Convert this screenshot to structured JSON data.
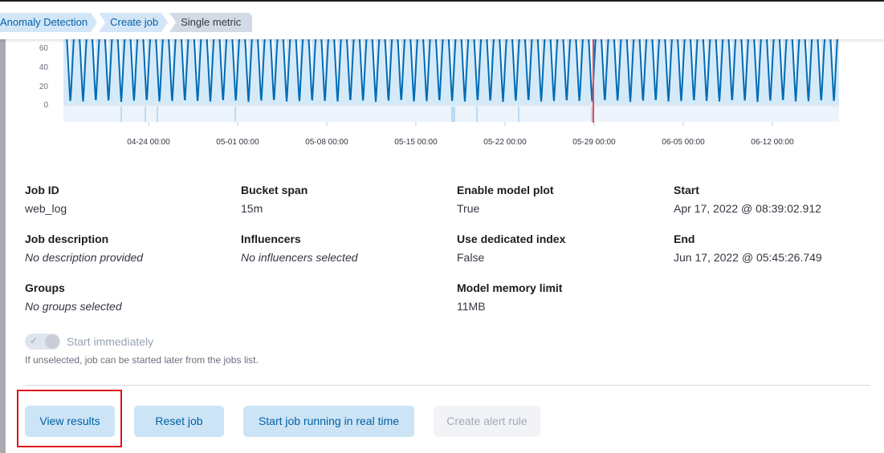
{
  "breadcrumbs": [
    "Anomaly Detection",
    "Create job",
    "Single metric"
  ],
  "chart_data": {
    "type": "line",
    "y_ticks": [
      "0",
      "20",
      "40",
      "60"
    ],
    "x_ticks": [
      "04-24 00:00",
      "05-01 00:00",
      "05-08 00:00",
      "05-15 00:00",
      "05-22 00:00",
      "05-29 00:00",
      "06-05 00:00",
      "06-12 00:00"
    ],
    "line_color": "#006bb4",
    "band_color": "#b9dcf5",
    "marker_color": "#f0454f"
  },
  "details": {
    "job_id": {
      "label": "Job ID",
      "value": "web_log"
    },
    "job_description": {
      "label": "Job description",
      "value": "No description provided"
    },
    "groups": {
      "label": "Groups",
      "value": "No groups selected"
    },
    "bucket_span": {
      "label": "Bucket span",
      "value": "15m"
    },
    "influencers": {
      "label": "Influencers",
      "value": "No influencers selected"
    },
    "enable_model_plot": {
      "label": "Enable model plot",
      "value": "True"
    },
    "use_dedicated_index": {
      "label": "Use dedicated index",
      "value": "False"
    },
    "model_memory_limit": {
      "label": "Model memory limit",
      "value": "11MB"
    },
    "start": {
      "label": "Start",
      "value": "Apr 17, 2022 @ 08:39:02.912"
    },
    "end": {
      "label": "End",
      "value": "Jun 17, 2022 @ 05:45:26.749"
    }
  },
  "start_toggle": {
    "label": "Start immediately",
    "checked": true,
    "disabled": true
  },
  "help_text": "If unselected, job can be started later from the jobs list.",
  "buttons": {
    "view_results": "View results",
    "reset_job": "Reset job",
    "start_realtime": "Start job running in real time",
    "create_alert_rule": "Create alert rule"
  }
}
